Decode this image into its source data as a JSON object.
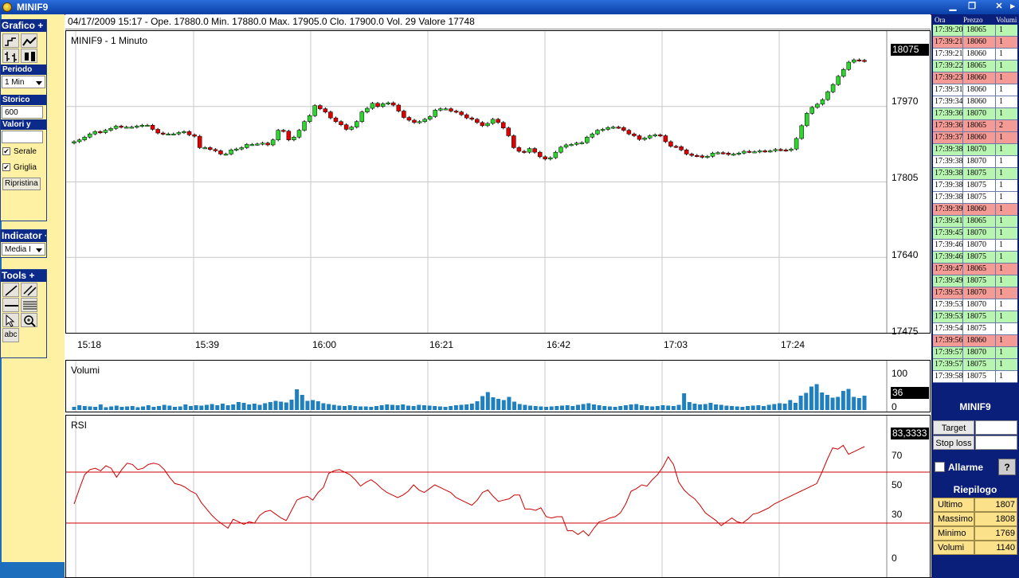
{
  "window": {
    "title": "MINIF9"
  },
  "left_panel": {
    "grafico": {
      "header": "Grafico +"
    },
    "periodo": {
      "label": "Periodo",
      "value": "1 Min"
    },
    "storico": {
      "label": "Storico",
      "value": "600"
    },
    "valori_y": {
      "label": "Valori y",
      "value": ""
    },
    "serale": {
      "label": "Serale",
      "checked": true
    },
    "griglia": {
      "label": "Griglia",
      "checked": true
    },
    "ripristina": "Ripristina",
    "indicator": {
      "header": "Indicator +",
      "value": "Media I"
    },
    "tools": {
      "header": "Tools +",
      "text_tool": "abc"
    }
  },
  "info_bar": "04/17/2009 15:17 - Ope. 17880.0 Min. 17880.0 Max. 17905.0 Clo. 17900.0 Vol. 29 Valore 17748",
  "price_pane": {
    "label": "MINIF9   - 1 Minuto",
    "last_price": "18075",
    "y_labels": [
      "17970",
      "17805",
      "17640",
      "17475"
    ]
  },
  "time_axis": [
    "15:18",
    "15:39",
    "16:00",
    "16:21",
    "16:42",
    "17:03",
    "17:24"
  ],
  "volume_pane": {
    "label": "Volumi",
    "y_max_label": "100",
    "last": "36",
    "y_min_label": "0"
  },
  "rsi_pane": {
    "label": "RSI",
    "last": "83,3333",
    "y_labels": [
      "70",
      "50",
      "30",
      "0"
    ],
    "bands": [
      70,
      30
    ]
  },
  "colors": {
    "up": "#2ed52e",
    "down": "#e00000",
    "volume": "#1f7fbf",
    "rsi": "#cc0000",
    "panel_blue": "#0a1f7a",
    "left_bg": "#fef1a3"
  },
  "chart_data": [
    {
      "type": "candlestick",
      "title": "MINIF9   - 1 Minuto",
      "x_ticks": [
        "15:18",
        "15:39",
        "16:00",
        "16:21",
        "16:42",
        "17:03",
        "17:24"
      ],
      "ylim": [
        17475,
        18135
      ],
      "values": [
        17893,
        17897,
        17903,
        17910,
        17915,
        17913,
        17918,
        17922,
        17927,
        17925,
        17925,
        17925,
        17927,
        17929,
        17929,
        17920,
        17912,
        17910,
        17910,
        17910,
        17913,
        17915,
        17908,
        17905,
        17880,
        17880,
        17876,
        17873,
        17866,
        17866,
        17875,
        17877,
        17880,
        17887,
        17887,
        17888,
        17890,
        17886,
        17897,
        17918,
        17916,
        17897,
        17903,
        17918,
        17937,
        17950,
        17972,
        17965,
        17958,
        17945,
        17937,
        17930,
        17920,
        17925,
        17937,
        17958,
        17966,
        17977,
        17970,
        17976,
        17978,
        17973,
        17960,
        17946,
        17940,
        17935,
        17937,
        17942,
        17948,
        17962,
        17965,
        17965,
        17960,
        17958,
        17952,
        17945,
        17942,
        17935,
        17928,
        17933,
        17942,
        17935,
        17923,
        17906,
        17880,
        17872,
        17870,
        17878,
        17870,
        17860,
        17855,
        17858,
        17870,
        17881,
        17886,
        17887,
        17890,
        17891,
        17903,
        17910,
        17918,
        17920,
        17924,
        17925,
        17924,
        17918,
        17910,
        17906,
        17898,
        17901,
        17906,
        17908,
        17906,
        17893,
        17883,
        17882,
        17875,
        17866,
        17863,
        17862,
        17859,
        17861,
        17868,
        17869,
        17868,
        17865,
        17866,
        17868,
        17872,
        17871,
        17871,
        17873,
        17872,
        17873,
        17876,
        17875,
        17874,
        17877,
        17900,
        17928,
        17955,
        17968,
        17975,
        17985,
        18002,
        18018,
        18036,
        18051,
        18067,
        18072,
        18071,
        18069
      ]
    },
    {
      "type": "bar",
      "title": "Volumi",
      "ylim": [
        0,
        100
      ],
      "values": [
        8,
        12,
        10,
        9,
        8,
        14,
        7,
        9,
        11,
        8,
        9,
        10,
        7,
        9,
        12,
        8,
        10,
        13,
        11,
        8,
        9,
        14,
        10,
        12,
        11,
        13,
        15,
        12,
        16,
        12,
        14,
        20,
        18,
        14,
        16,
        13,
        17,
        20,
        23,
        21,
        19,
        26,
        52,
        38,
        23,
        25,
        22,
        17,
        15,
        13,
        11,
        10,
        12,
        10,
        9,
        9,
        8,
        10,
        12,
        14,
        13,
        12,
        14,
        11,
        10,
        13,
        12,
        11,
        10,
        9,
        8,
        10,
        12,
        13,
        14,
        16,
        22,
        35,
        45,
        32,
        28,
        25,
        33,
        21,
        15,
        13,
        11,
        10,
        9,
        8,
        9,
        10,
        11,
        12,
        10,
        13,
        15,
        17,
        14,
        12,
        10,
        9,
        8,
        10,
        12,
        14,
        15,
        12,
        10,
        9,
        10,
        12,
        11,
        10,
        13,
        42,
        20,
        16,
        14,
        15,
        18,
        14,
        13,
        11,
        10,
        9,
        8,
        10,
        11,
        12,
        10,
        13,
        15,
        17,
        16,
        25,
        18,
        36,
        43,
        59,
        65,
        44,
        38,
        31,
        33,
        48,
        53,
        33,
        30,
        36
      ]
    },
    {
      "type": "line",
      "title": "RSI",
      "ylim": [
        0,
        100
      ],
      "bands": [
        70,
        30
      ],
      "values": [
        45,
        57,
        68,
        72,
        73,
        71,
        75,
        73,
        66,
        72,
        77,
        76,
        72,
        73,
        76,
        77,
        76,
        72,
        66,
        61,
        60,
        58,
        55,
        53,
        46,
        41,
        36,
        32,
        29,
        26,
        33,
        31,
        29,
        31,
        30,
        36,
        39,
        40,
        37,
        34,
        32,
        40,
        48,
        50,
        51,
        48,
        54,
        58,
        69,
        71,
        72,
        70,
        68,
        64,
        59,
        62,
        64,
        61,
        57,
        54,
        52,
        50,
        52,
        55,
        60,
        56,
        54,
        57,
        60,
        58,
        56,
        54,
        50,
        48,
        46,
        44,
        48,
        54,
        56,
        51,
        47,
        48,
        49,
        52,
        52,
        41,
        41,
        40,
        42,
        35,
        34,
        35,
        35,
        24,
        24,
        21,
        24,
        20,
        26,
        31,
        32,
        34,
        35,
        38,
        45,
        55,
        57,
        60,
        59,
        64,
        68,
        74,
        82,
        76,
        62,
        56,
        52,
        49,
        44,
        38,
        35,
        32,
        28,
        31,
        34,
        31,
        30,
        33,
        37,
        38,
        40,
        42,
        45,
        47,
        49,
        51,
        53,
        55,
        57,
        59,
        61,
        70,
        80,
        89,
        88,
        91,
        84,
        86,
        88,
        90
      ]
    }
  ],
  "ticks_table": {
    "headers": [
      "Ora",
      "Prezzo",
      "Volumi"
    ],
    "rows": [
      {
        "time": "17:39:20",
        "price": "18065",
        "vol": "1",
        "dir": "up"
      },
      {
        "time": "17:39:21",
        "price": "18060",
        "vol": "1",
        "dir": "down"
      },
      {
        "time": "17:39:21",
        "price": "18060",
        "vol": "1",
        "dir": "flat"
      },
      {
        "time": "17:39:22",
        "price": "18065",
        "vol": "1",
        "dir": "up"
      },
      {
        "time": "17:39:23",
        "price": "18060",
        "vol": "1",
        "dir": "down"
      },
      {
        "time": "17:39:31",
        "price": "18060",
        "vol": "1",
        "dir": "flat"
      },
      {
        "time": "17:39:34",
        "price": "18060",
        "vol": "1",
        "dir": "flat"
      },
      {
        "time": "17:39:36",
        "price": "18070",
        "vol": "1",
        "dir": "up"
      },
      {
        "time": "17:39:36",
        "price": "18065",
        "vol": "2",
        "dir": "down"
      },
      {
        "time": "17:39:37",
        "price": "18060",
        "vol": "1",
        "dir": "down"
      },
      {
        "time": "17:39:38",
        "price": "18070",
        "vol": "1",
        "dir": "up"
      },
      {
        "time": "17:39:38",
        "price": "18070",
        "vol": "1",
        "dir": "flat"
      },
      {
        "time": "17:39:38",
        "price": "18075",
        "vol": "1",
        "dir": "up"
      },
      {
        "time": "17:39:38",
        "price": "18075",
        "vol": "1",
        "dir": "flat"
      },
      {
        "time": "17:39:38",
        "price": "18075",
        "vol": "1",
        "dir": "flat"
      },
      {
        "time": "17:39:39",
        "price": "18060",
        "vol": "1",
        "dir": "down"
      },
      {
        "time": "17:39:41",
        "price": "18065",
        "vol": "1",
        "dir": "up"
      },
      {
        "time": "17:39:45",
        "price": "18070",
        "vol": "1",
        "dir": "up"
      },
      {
        "time": "17:39:46",
        "price": "18070",
        "vol": "1",
        "dir": "flat"
      },
      {
        "time": "17:39:46",
        "price": "18075",
        "vol": "1",
        "dir": "up"
      },
      {
        "time": "17:39:47",
        "price": "18065",
        "vol": "1",
        "dir": "down"
      },
      {
        "time": "17:39:49",
        "price": "18075",
        "vol": "1",
        "dir": "up"
      },
      {
        "time": "17:39:53",
        "price": "18070",
        "vol": "1",
        "dir": "down"
      },
      {
        "time": "17:39:53",
        "price": "18070",
        "vol": "1",
        "dir": "flat"
      },
      {
        "time": "17:39:53",
        "price": "18075",
        "vol": "1",
        "dir": "up"
      },
      {
        "time": "17:39:54",
        "price": "18075",
        "vol": "1",
        "dir": "flat"
      },
      {
        "time": "17:39:56",
        "price": "18060",
        "vol": "1",
        "dir": "down"
      },
      {
        "time": "17:39:57",
        "price": "18070",
        "vol": "1",
        "dir": "up"
      },
      {
        "time": "17:39:57",
        "price": "18075",
        "vol": "1",
        "dir": "up"
      },
      {
        "time": "17:39:58",
        "price": "18075",
        "vol": "1",
        "dir": "flat"
      }
    ]
  },
  "right_panel": {
    "symbol": "MINIF9",
    "target_label": "Target",
    "stoploss_label": "Stop loss",
    "allarme_label": "Allarme",
    "help_label": "?",
    "riepilogo_label": "Riepilogo",
    "summary": [
      {
        "label": "Ultimo",
        "value": "1807"
      },
      {
        "label": "Massimo",
        "value": "1808"
      },
      {
        "label": "Minimo",
        "value": "1769"
      },
      {
        "label": "Volumi",
        "value": "1140"
      }
    ]
  }
}
